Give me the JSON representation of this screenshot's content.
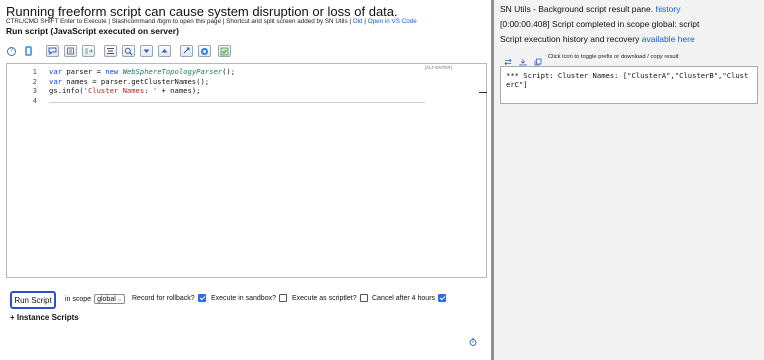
{
  "left": {
    "warning_title": "Running freeform script can cause system disruption or loss of data.",
    "info_text": "CTRL/CMD SHIFT Enter to Execute | Slashcommand /bgm to open this page | Shortcut and split screen added by SN Utils |",
    "info_old_link": "Old",
    "info_sep": " | ",
    "info_vscode_link": "Open in VS Code",
    "run_title": "Run script (JavaScript executed on server)",
    "toolbar": {
      "help_icon": "?",
      "icons": [
        "debug-icon",
        "comment-icon",
        "format-icon",
        "replace-icon",
        "search-icon",
        "fold-icon",
        "unfold-icon",
        "fullscreen-icon",
        "syntax-check-icon",
        "toggle-theme-icon"
      ]
    },
    "editor": {
      "hint_label": "[ALT-ENTER]",
      "lines": [
        {
          "num": "1",
          "parts": [
            {
              "t": "var",
              "c": "kw"
            },
            {
              "t": " parser = ",
              "c": ""
            },
            {
              "t": "new",
              "c": "kw"
            },
            {
              "t": " ",
              "c": ""
            },
            {
              "t": "WebSphereTopologyParser",
              "c": "cls"
            },
            {
              "t": "();",
              "c": ""
            }
          ]
        },
        {
          "num": "2",
          "parts": [
            {
              "t": "var",
              "c": "kw"
            },
            {
              "t": " names = parser.getClusterNames();",
              "c": ""
            }
          ]
        },
        {
          "num": "3",
          "parts": [
            {
              "t": "gs",
              "c": "fn"
            },
            {
              "t": ".info(",
              "c": ""
            },
            {
              "t": "'Cluster Names: '",
              "c": "str"
            },
            {
              "t": " + names);",
              "c": ""
            }
          ]
        },
        {
          "num": "4",
          "parts": []
        }
      ]
    },
    "run_button": "Run Script",
    "scope_label": "in scope",
    "scope_value": "global",
    "rollback_label": "Record for rollback?",
    "rollback_checked": true,
    "sandbox_label": "Execute in sandbox?",
    "sandbox_checked": false,
    "scriptlet_label": "Execute as scriptlet?",
    "scriptlet_checked": false,
    "cancel_label": "Cancel after 4 hours",
    "cancel_checked": true,
    "instance_scripts": "+ Instance Scripts"
  },
  "right": {
    "title": "SN Utils - Background script result pane.",
    "history_link": "history",
    "status": "[0:00:00.408] Script completed in scope global: script",
    "history_text": "Script execution history and recovery",
    "available_link": "available here",
    "icons": [
      "swap-icon",
      "download-icon",
      "copy-icon"
    ],
    "hint": "Click icon to toggle prefix or download / copy result",
    "output": "*** Script: Cluster Names: [\"ClusterA\",\"ClusterB\",\"ClusterC\"]"
  },
  "colors": {
    "accent": "#2a4fd1",
    "link": "#1a5bc2",
    "checkbox": "#2a6fe6",
    "divider": "#8f8f8f"
  }
}
